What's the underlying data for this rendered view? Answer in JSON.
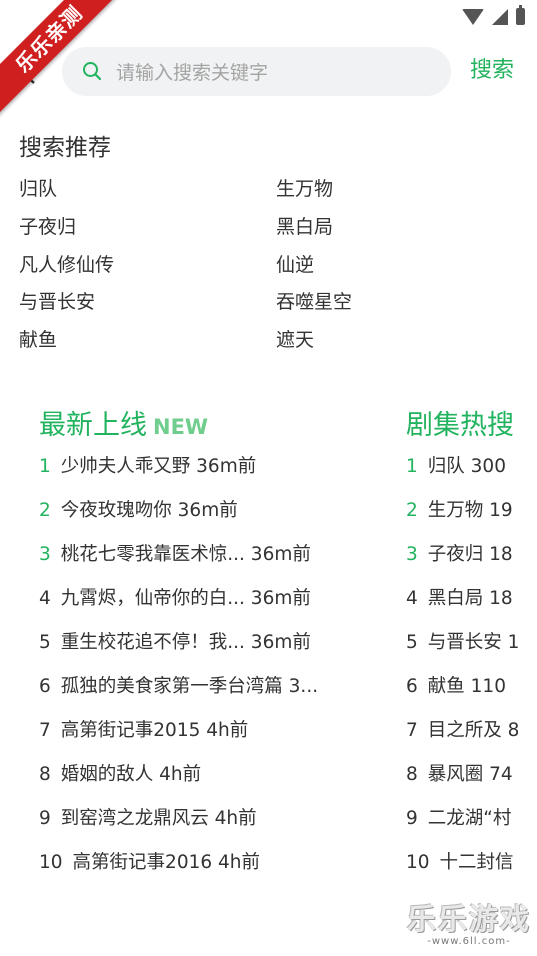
{
  "watermark_ribbon": "乐乐亲测",
  "search": {
    "placeholder": "请输入搜索关键字",
    "button_label": "搜索"
  },
  "recommend": {
    "title": "搜索推荐",
    "items": [
      "归队",
      "生万物",
      "子夜归",
      "黑白局",
      "凡人修仙传",
      "仙逆",
      "与晋长安",
      "吞噬星空",
      "献鱼",
      "遮天"
    ]
  },
  "latest": {
    "title": "最新上线",
    "badge": "NEW",
    "items": [
      {
        "rank": "1",
        "text": "少帅夫人乖又野 36m前"
      },
      {
        "rank": "2",
        "text": "今夜玫瑰吻你 36m前"
      },
      {
        "rank": "3",
        "text": "桃花七零我靠医术惊... 36m前"
      },
      {
        "rank": "4",
        "text": "九霄烬，仙帝你的白... 36m前"
      },
      {
        "rank": "5",
        "text": "重生校花追不停！我... 36m前"
      },
      {
        "rank": "6",
        "text": "孤独的美食家第一季台湾篇 3..."
      },
      {
        "rank": "7",
        "text": "高第街记事2015 4h前"
      },
      {
        "rank": "8",
        "text": "婚姻的敌人 4h前"
      },
      {
        "rank": "9",
        "text": "到窑湾之龙鼎风云 4h前"
      },
      {
        "rank": "10",
        "text": "高第街记事2016 4h前"
      }
    ]
  },
  "hot": {
    "title": "剧集热搜",
    "items": [
      {
        "rank": "1",
        "text": "归队 300"
      },
      {
        "rank": "2",
        "text": "生万物 19"
      },
      {
        "rank": "3",
        "text": "子夜归 18"
      },
      {
        "rank": "4",
        "text": "黑白局 18"
      },
      {
        "rank": "5",
        "text": "与晋长安 1"
      },
      {
        "rank": "6",
        "text": "献鱼 110"
      },
      {
        "rank": "7",
        "text": "目之所及 8"
      },
      {
        "rank": "8",
        "text": "暴风圈 74"
      },
      {
        "rank": "9",
        "text": "二龙湖“村"
      },
      {
        "rank": "10",
        "text": "十二封信"
      }
    ]
  },
  "watermark_bottom": {
    "main": "乐乐游戏",
    "sub": "-www.6ll.com-"
  },
  "colors": {
    "accent": "#22b35e",
    "text": "#333333",
    "search_bg": "#f1f2f3"
  }
}
